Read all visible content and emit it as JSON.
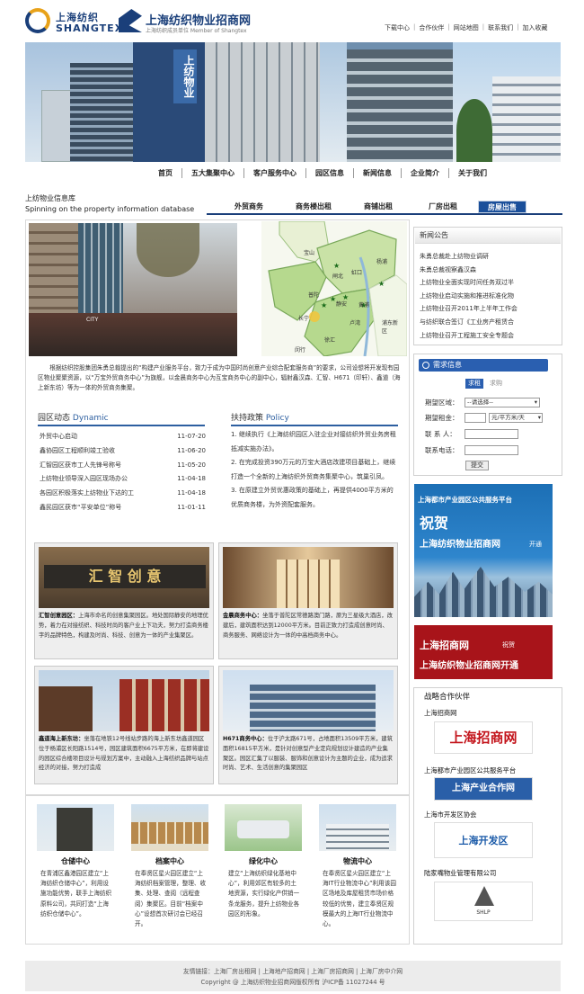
{
  "header": {
    "logo_cn": "上海纺织",
    "logo_en": "SHANGTEX",
    "site_title": "上海纺织物业招商网",
    "site_sub": "上海纺织成员单位  Member of Shangtex",
    "toplinks": [
      "下载中心",
      "合作伙伴",
      "网站地图",
      "联系我们",
      "加入收藏"
    ]
  },
  "banner": {
    "building_sign": "上纺物业"
  },
  "nav": [
    "首页",
    "五大集聚中心",
    "客户服务中心",
    "园区信息",
    "新闻信息",
    "企业简介",
    "关于我们"
  ],
  "library": {
    "title": "上纺物业信息库",
    "subtitle": "Spinning on the property information database",
    "tabs": [
      "外贸商务",
      "商务楼出租",
      "商铺出租",
      "厂房出租",
      "房屋出售"
    ],
    "active_tab": 4
  },
  "street_sign": "CITY",
  "map": {
    "districts": [
      "宝山",
      "虹口",
      "杨浦",
      "闸北",
      "普陀",
      "静安",
      "长宁",
      "黄浦",
      "卢湾",
      "徐汇",
      "闵行",
      "浦东新区"
    ]
  },
  "intro": "根据纺织控股集团朱勇总裁提出的“构建产业服务平台，致力于成为中国时尚创意产业综合配套服务商”的要求，公司设想将开发现有园区物业聚聚资源，以“万宝外贸商务中心”为旗舰，以金晨商务中心为互宝商务中心的副中心，辐射鑫汉森、汇智、H671（印轩）、鑫道（海上新东坊）等为一体的外贸商务集聚。",
  "dynamic": {
    "title": "园区动态",
    "title_en": "Dynamic",
    "items": [
      {
        "text": "外贸中心启动",
        "date": "11-07-20"
      },
      {
        "text": "鑫协园区工程顺利竣工验收",
        "date": "11-06-20"
      },
      {
        "text": "汇智园区获市工人先锋号称号",
        "date": "11-05-20"
      },
      {
        "text": "上纺物业领导深入园区现场办公",
        "date": "11-04-18"
      },
      {
        "text": "各园区积极落实上纺物业下达的工",
        "date": "11-04-18"
      },
      {
        "text": "鑫民园区获市“平安单位”称号",
        "date": "11-01-11"
      }
    ]
  },
  "policy": {
    "title": "扶持政策",
    "title_en": "Policy",
    "items": [
      "1. 继续执行《上海纺织园区入驻企业对接纺织外贸业务房租抵减实施办法》。",
      "2. 在完成投资390万元的万宝大酒店改建项目基础上，继续打造一个全新的上海纺织外贸商务集聚中心，筑巢引凤。",
      "3. 在原建立外贸优惠政策的基础上，再提供4000平方米的优质商务楼，为外资配套服务。"
    ]
  },
  "cards": [
    {
      "photo_text": "汇 智 创 意",
      "name": "汇智创意园区：",
      "text": "上海市命名的创意集聚园区。地处国际静安的地理优势，着力在对接纺织、科技时尚的客户业上下功夫，努力打造商务楼字的品牌特色，构建及时尚、科技、创意为一体的产业集聚区。"
    },
    {
      "photo_text": "",
      "name": "金晨商务中心：",
      "text": "坐落于普陀区常德路澳门路，原为三星级大酒店，改建后，建筑面积达到12000平方米。目前正致力打造成创意时尚、商务服务、网络设计为一体的中高档商务中心。"
    },
    {
      "photo_text": "",
      "name": "鑫道海上新东坊：",
      "text": "坐落在地铁12号线站步路的海上新东坊鑫道园区位于杨浦区长阳路1514号，园区建筑面积6675平方米，在即将建设的园区综合楼项目设计与规划方案中，主动融入上海纺织品牌与站点经济的对接，努力打造成"
    },
    {
      "photo_text": "",
      "name": "H671商务中心：",
      "text": "位于沪太路671号，占地面积13509平方米，建筑面积16815平方米，是针对创意型产业定向规划设计建造的产业集聚区。园区汇集了以服装、服饰和创意设计为主题的企业，成为追求时尚、艺术、生活创意的集聚园区"
    }
  ],
  "centers": [
    {
      "name": "仓储中心",
      "desc": "在青浦区鑫港园区建立“上海纺织仓储中心”，利用设施功能优势，联手上海纺织原料公司，共同打造“上海纺织仓储中心”。"
    },
    {
      "name": "档案中心",
      "desc": "在奉贤区星火园区建立“上海纺织档案管理，整理、收集、处理、查阅（远程查阅）集聚区。目前“档案中心”设想首次研讨会已经召开。"
    },
    {
      "name": "绿化中心",
      "desc": "建立“上海纺织绿化基地中心”，利用郊区有较多的土地资源，实行绿化产供销一条龙服务，提升上纺物业各园区的形象。"
    },
    {
      "name": "物流中心",
      "desc": "在奉贤区星火园区建立“上海IT行业物流中心”利用该园区场地及库屋租赁市场价格较低的优势，建立奉贤区规模最大的上海IT行业物流中心。"
    }
  ],
  "news": {
    "title": "新闻公告",
    "items": [
      "朱勇总裁赴上纺物业调研",
      "朱勇总裁视察鑫汉森",
      "上纺物业全面实现时间任务双过半",
      "上纺物业启动实施和推进标准化物",
      "上纺物业召开2011年上半年工作会",
      "与纺织联合签订《工业房产租赁合",
      "上纺物业召开工程施工安全专题会"
    ]
  },
  "demand": {
    "title": "需求信息",
    "tab_rent": "求租",
    "tab_buy": "求购",
    "area_label": "期望区域：",
    "area_value": "--请选择--",
    "rent_label": "期望租金：",
    "rent_unit": "元/平方米/天",
    "contact_label": "联 系 人：",
    "phone_label": "联系电话：",
    "submit": "提交"
  },
  "ad1": {
    "line1": "上海都市产业园区公共服务平台",
    "line2": "祝贺",
    "line3": "上海纺织物业招商网",
    "line4": "开通"
  },
  "ad2": {
    "line1": "上海招商网",
    "line2": "祝贺",
    "line3": "上海纺织物业招商网开通"
  },
  "partners": {
    "title": "战略合作伙伴",
    "items": [
      {
        "label": "上海招商网",
        "logo_text": "上海招商网"
      },
      {
        "label": "上海都市产业园区公共服务平台",
        "logo_text": "上海产业合作网"
      },
      {
        "label": "上海市开发区协会",
        "logo_text": "上海开发区"
      },
      {
        "label": "陆家嘴物业管理有限公司",
        "logo_text": "SHLP"
      }
    ]
  },
  "footer": {
    "links": "友情链接：上海厂房出租网 | 上海地产招商网 | 上海厂房招商网 | 上海厂房中介网",
    "copyright": "Copyright @ 上海纺织物业招商网版权所有 沪ICP备 11027244 号"
  },
  "colors": {
    "brand": "#1a3f7a",
    "accent": "#2d5fa0",
    "ad_red": "#a8141a"
  }
}
